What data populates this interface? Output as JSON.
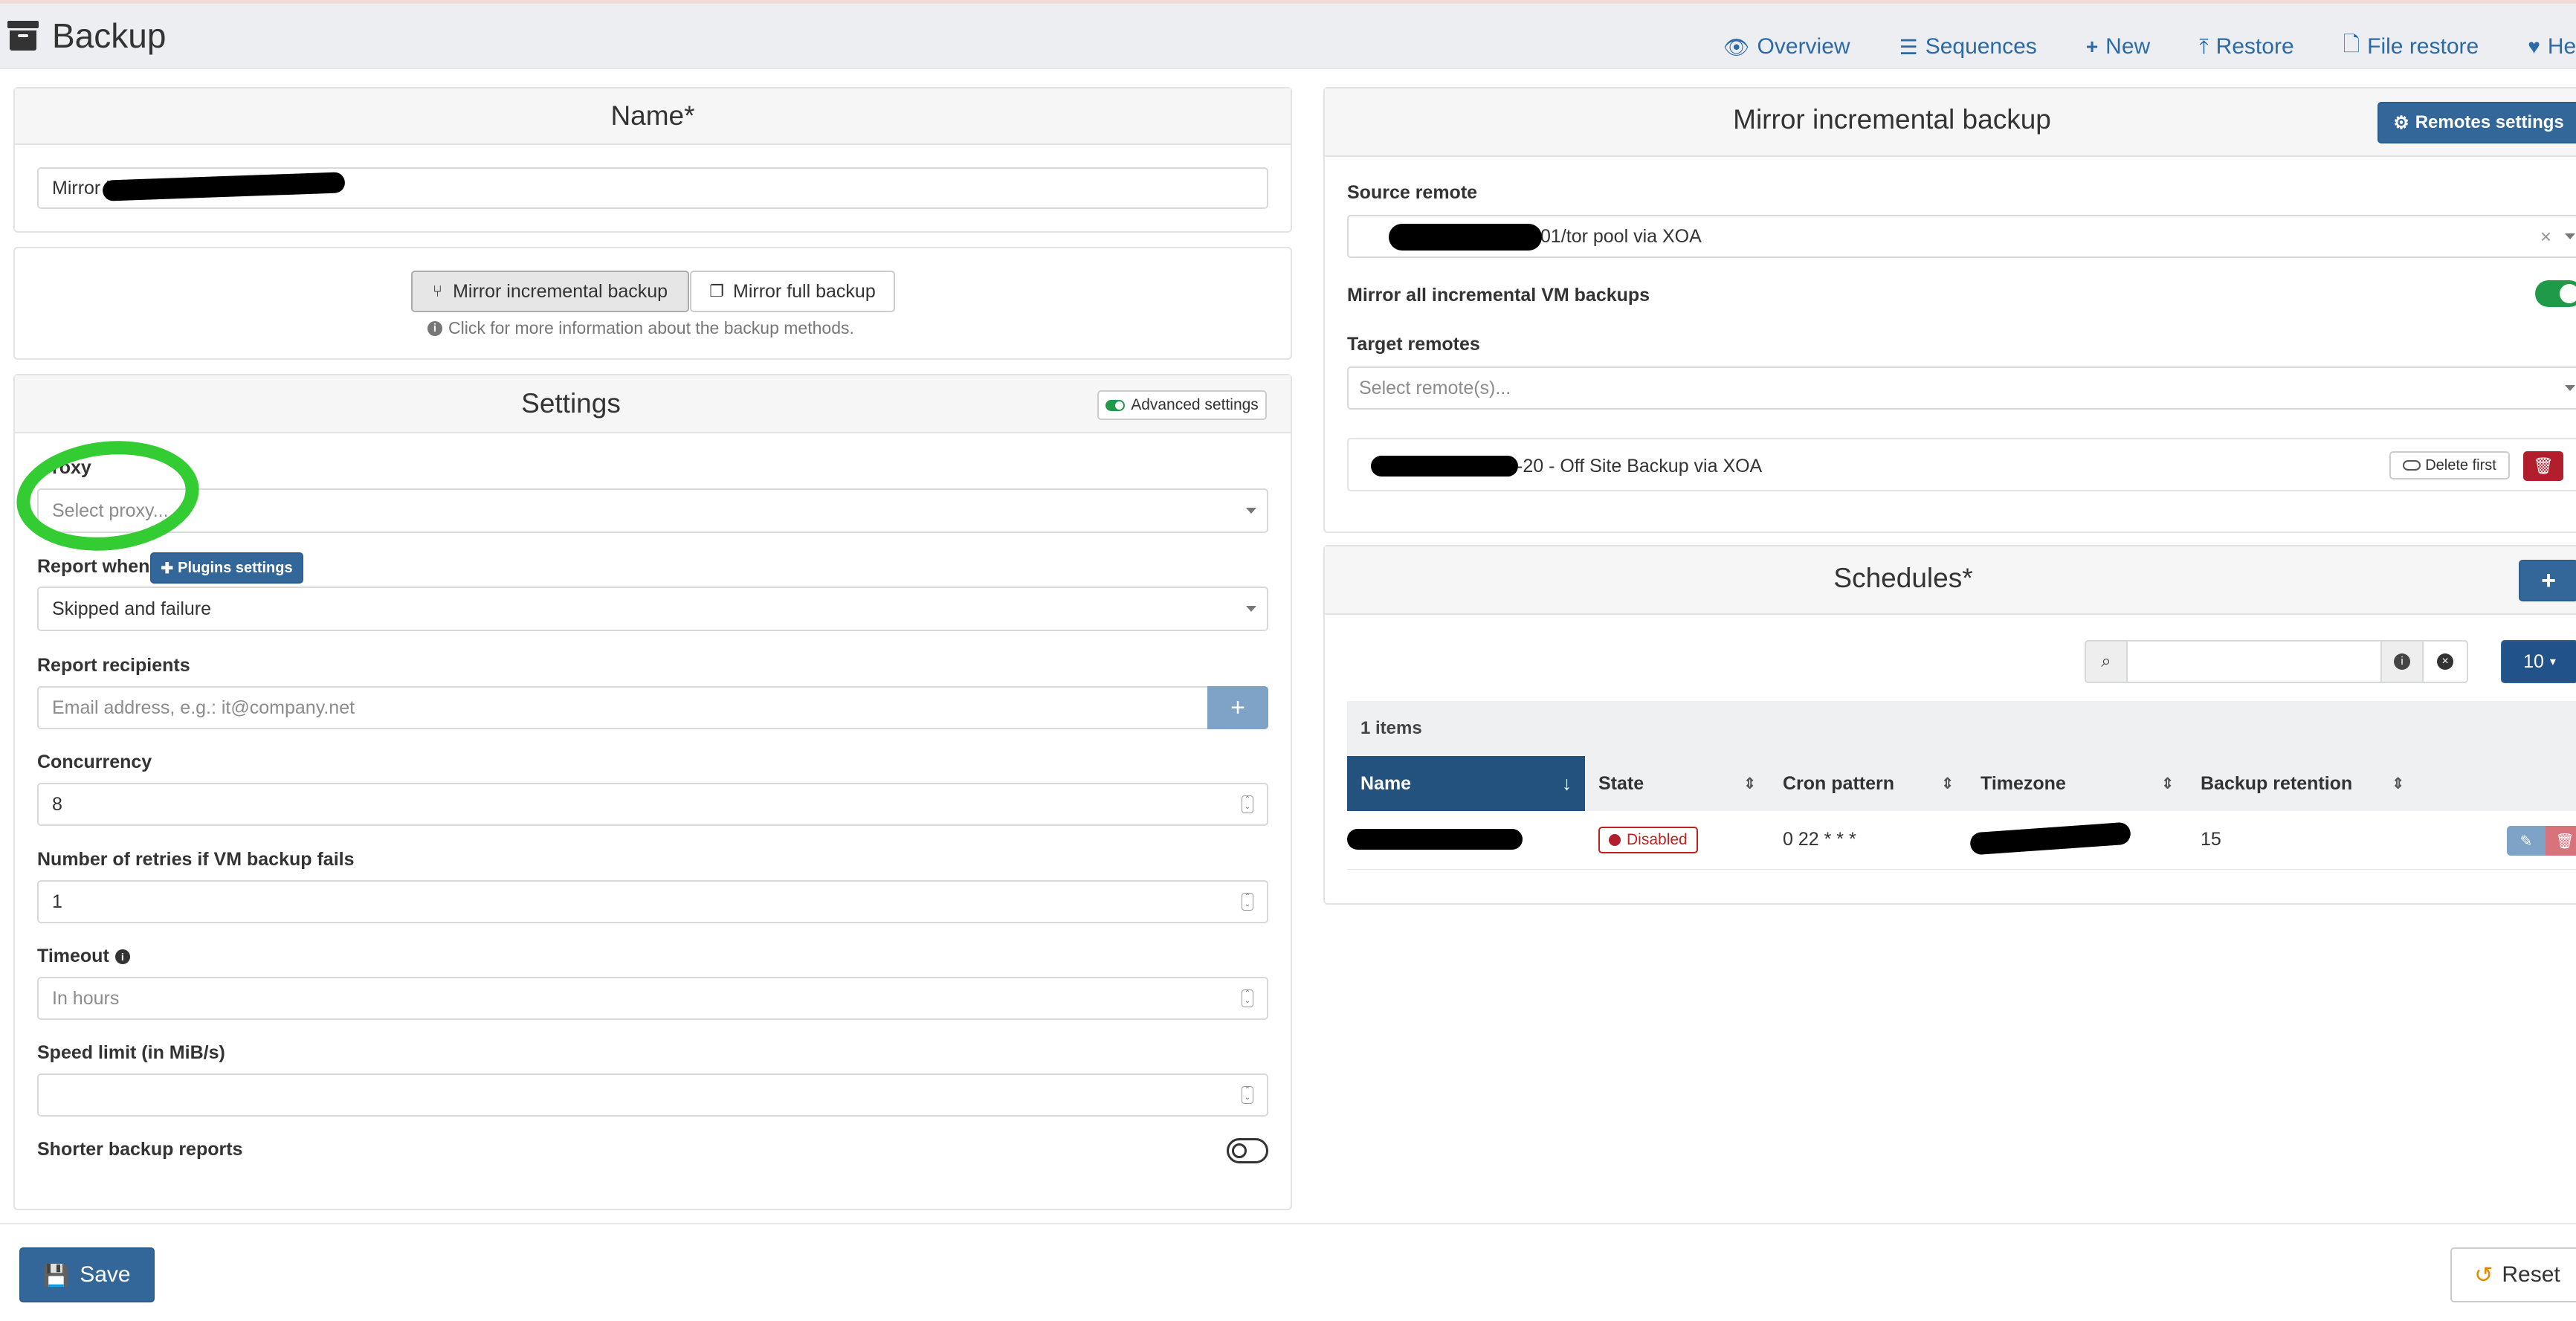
{
  "header": {
    "title": "Backup",
    "nav": [
      {
        "label": "Overview",
        "icon": "eye-icon"
      },
      {
        "label": "Sequences",
        "icon": "list-icon"
      },
      {
        "label": "New",
        "icon": "plus-icon"
      },
      {
        "label": "Restore",
        "icon": "upload-icon"
      },
      {
        "label": "File restore",
        "icon": "file-icon"
      },
      {
        "label": "Healt",
        "icon": "heart-icon"
      }
    ]
  },
  "name_panel": {
    "title": "Name*",
    "value": "Mirror in"
  },
  "mode_panel": {
    "incremental_label": "Mirror incremental backup",
    "full_label": "Mirror full backup",
    "info_text": "Click for more information about the backup methods."
  },
  "settings": {
    "title": "Settings",
    "advanced_label": "Advanced settings",
    "proxy_label": "roxy",
    "proxy_placeholder": "Select proxy...",
    "report_when_label": "Report when",
    "plugins_settings_label": "Plugins settings",
    "report_when_value": "Skipped and failure",
    "report_recipients_label": "Report recipients",
    "report_recipients_placeholder": "Email address, e.g.: it@company.net",
    "concurrency_label": "Concurrency",
    "concurrency_value": "8",
    "retries_label": "Number of retries if VM backup fails",
    "retries_value": "1",
    "timeout_label": "Timeout",
    "timeout_placeholder": "In hours",
    "speed_label": "Speed limit (in MiB/s)",
    "speed_value": "",
    "shorter_reports_label": "Shorter backup reports"
  },
  "mirror_panel": {
    "title": "Mirror incremental backup",
    "remotes_settings_label": "Remotes settings",
    "source_remote_label": "Source remote",
    "source_remote_value": "01/tor pool via XOA",
    "mirror_all_label": "Mirror all incremental VM backups",
    "target_remotes_label": "Target remotes",
    "target_remotes_placeholder": "Select remote(s)...",
    "target_item": "-20 - Off Site Backup via XOA",
    "delete_first_label": "Delete first"
  },
  "schedules": {
    "title": "Schedules*",
    "page_size": "10",
    "items_count": "1 items",
    "columns": [
      "Name",
      "State",
      "Cron pattern",
      "Timezone",
      "Backup retention"
    ],
    "rows": [
      {
        "name": "",
        "state": "Disabled",
        "cron": "0 22 * * *",
        "timezone": "",
        "retention": "15"
      }
    ]
  },
  "footer": {
    "save_label": "Save",
    "reset_label": "Reset"
  },
  "colors": {
    "primary": "#336699",
    "danger": "#b21e2b",
    "success": "#1f9a49",
    "annotation": "#33cc33"
  }
}
